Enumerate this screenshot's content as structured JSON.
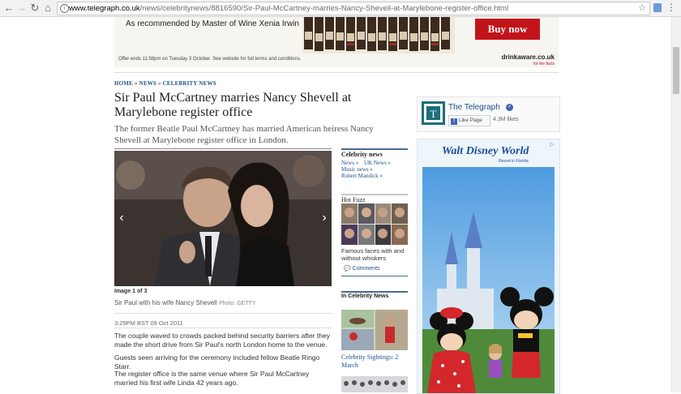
{
  "browser": {
    "url_domain": "www.telegraph.co.uk",
    "url_path": "/news/celebritynews/8816590/Sir-Paul-McCartney-marries-Nancy-Shevell-at-Marylebone-register-office.html",
    "icons": [
      "back-icon",
      "forward-icon",
      "reload-icon",
      "home-icon",
      "info-icon",
      "star-icon",
      "extension-icon",
      "menu-icon"
    ]
  },
  "top_ad": {
    "tagline": "As recommended by Master of Wine Xenia Irwin",
    "button": "Buy now",
    "fine_print": "Offer ends 11:59pm on Tuesday 3 October. See website for full terms and conditions.",
    "brand": "drinkaware.co.uk",
    "brand_sub": "for the facts"
  },
  "breadcrumb": [
    "HOME",
    "NEWS",
    "CELEBRITY NEWS"
  ],
  "article": {
    "headline": "Sir Paul McCartney marries Nancy Shevell at Marylebone register office",
    "standfirst": "The former Beatle Paul McCartney has married American heiress Nancy Shevell at Marylebone register office in London.",
    "image_count": "Image 1 of 3",
    "caption": "Sir Paul with his wife Nancy Shevell",
    "credit": "Photo: GETTY",
    "timestamp": "3:29PM BST 09 Oct 2011",
    "paragraphs": [
      "The couple waved to crowds packed behind security barriers after they made the short drive from Sir Paul's north London home to the venue.",
      "Guests seen arriving for the ceremony included fellow Beatle Ringo Starr.",
      "The register office is the same venue where Sir Paul McCartney married his first wife Linda 42 years ago."
    ]
  },
  "middle": {
    "celeb_title": "Celebrity news",
    "celeb_links": [
      "News »",
      "UK News »",
      "Music news »",
      "Robert Mandick »"
    ],
    "hotfuzz_title": "Hot Fuzz",
    "hotfuzz_text": "Famous faces with and without whiskers",
    "comments": "Comments",
    "in_celeb_title": "In Celebrity News",
    "sightings": "Celebrity Sightings: 2 March"
  },
  "telegraph_box": {
    "name": "The Telegraph",
    "like": "Like Page",
    "likes": "4.3M likes"
  },
  "disney_ad": {
    "logo": "Walt Disney World",
    "sub": "Resort in Florida"
  },
  "colors": {
    "link": "#1c4f86",
    "ad_red": "#c1141a",
    "tg_teal": "#1c6e78"
  }
}
